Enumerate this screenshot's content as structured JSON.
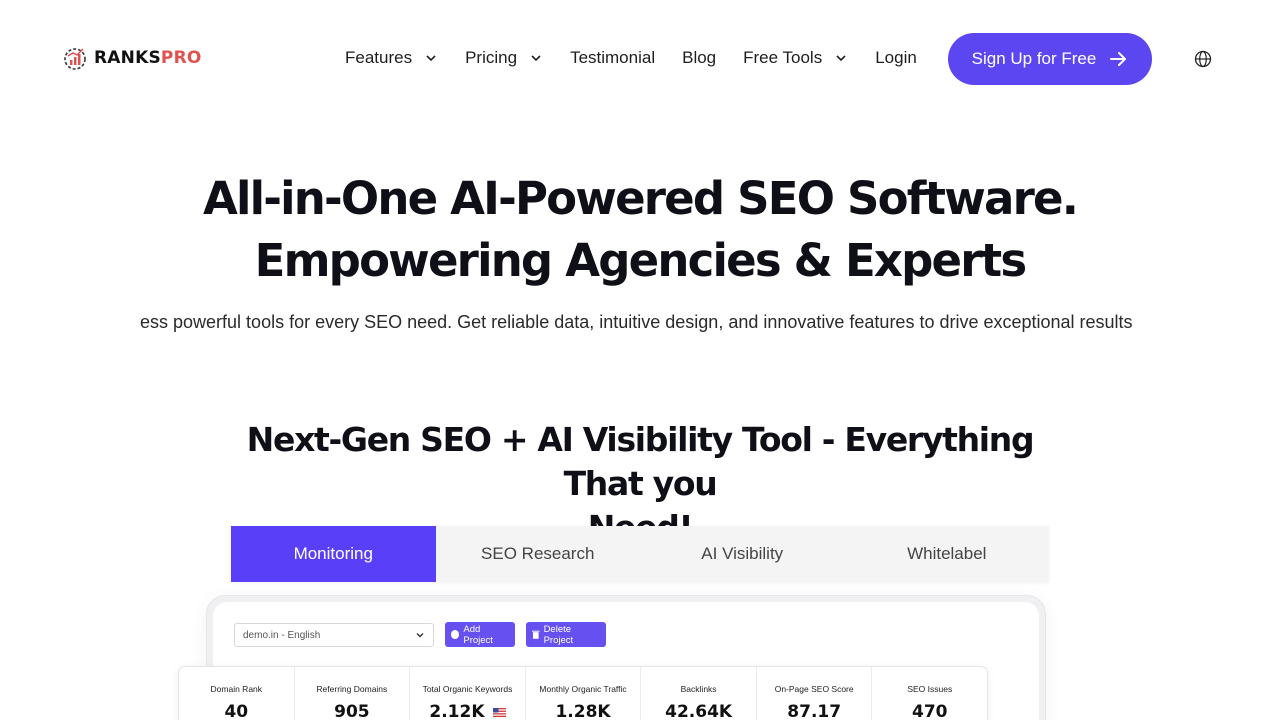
{
  "brand": {
    "name_part1": "RANKS",
    "name_part2": "PRO",
    "accent": "#5b46f2",
    "logo_red": "#e05252"
  },
  "nav": {
    "items": [
      {
        "label": "Features",
        "dropdown": true
      },
      {
        "label": "Pricing",
        "dropdown": true
      },
      {
        "label": "Testimonial",
        "dropdown": false
      },
      {
        "label": "Blog",
        "dropdown": false
      },
      {
        "label": "Free Tools",
        "dropdown": true
      },
      {
        "label": "Login",
        "dropdown": false
      }
    ],
    "cta_label": "Sign Up for Free",
    "language_icon": "globe-icon"
  },
  "hero": {
    "title_line1": "All-in-One AI-Powered SEO Software.",
    "title_line2": "Empowering Agencies & Experts",
    "subtitle": "Access powerful tools for every SEO need. Get reliable data, intuitive design, and innovative features to drive exceptional results"
  },
  "section": {
    "title_line1": "Next-Gen SEO + AI Visibility Tool - Everything That you",
    "title_line2": "Need!"
  },
  "tabs": [
    {
      "label": "Monitoring",
      "active": true
    },
    {
      "label": "SEO Research",
      "active": false
    },
    {
      "label": "AI Visibility",
      "active": false
    },
    {
      "label": "Whitelabel",
      "active": false
    }
  ],
  "dashboard": {
    "project_select_value": "demo.in - English",
    "add_project_label": "Add Project",
    "delete_project_label": "Delete Project",
    "stats": [
      {
        "label": "Domain Rank",
        "value": "40"
      },
      {
        "label": "Referring Domains",
        "value": "905"
      },
      {
        "label": "Total Organic Keywords",
        "value": "2.12K",
        "flag": "us-flag-icon"
      },
      {
        "label": "Monthly Organic Traffic",
        "value": "1.28K"
      },
      {
        "label": "Backlinks",
        "value": "42.64K"
      },
      {
        "label": "On-Page SEO Score",
        "value": "87.17"
      },
      {
        "label": "SEO Issues",
        "value": "470"
      }
    ]
  }
}
